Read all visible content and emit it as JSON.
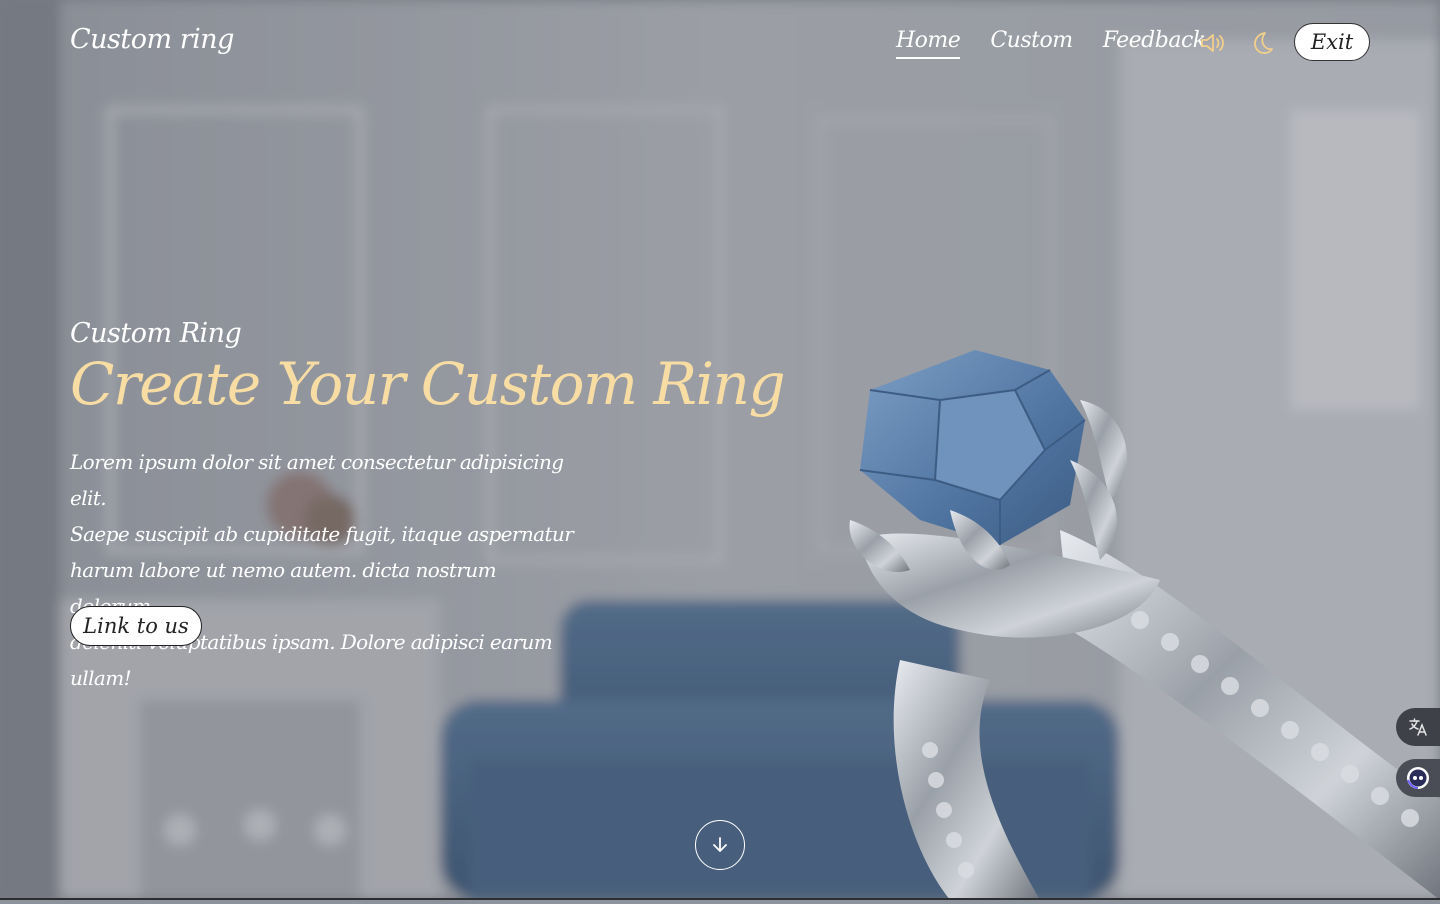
{
  "header": {
    "logo": "Custom ring",
    "nav": [
      {
        "label": "Home",
        "active": true
      },
      {
        "label": "Custom",
        "active": false
      },
      {
        "label": "Feedback",
        "active": false
      }
    ],
    "icons": [
      "sound-icon",
      "moon-icon"
    ],
    "exit_label": "Exit"
  },
  "hero": {
    "eyebrow": "Custom Ring",
    "title": "Create Your Custom Ring",
    "body_lines": [
      "Lorem ipsum dolor sit amet consectetur adipisicing elit.",
      "Saepe suscipit ab cupiditate fugit, itaque aspernatur",
      "harum labore ut nemo autem. dicta nostrum dolorum",
      "deleniti voluptatibus ipsam. Dolore adipisci earum ullam!"
    ],
    "cta_label": "Link to us"
  },
  "side_buttons": [
    "translate-icon",
    "assistant-icon"
  ],
  "colors": {
    "accent": "#f7dda3",
    "icon_accent": "#f2cf8a",
    "text": "#ffffff"
  }
}
